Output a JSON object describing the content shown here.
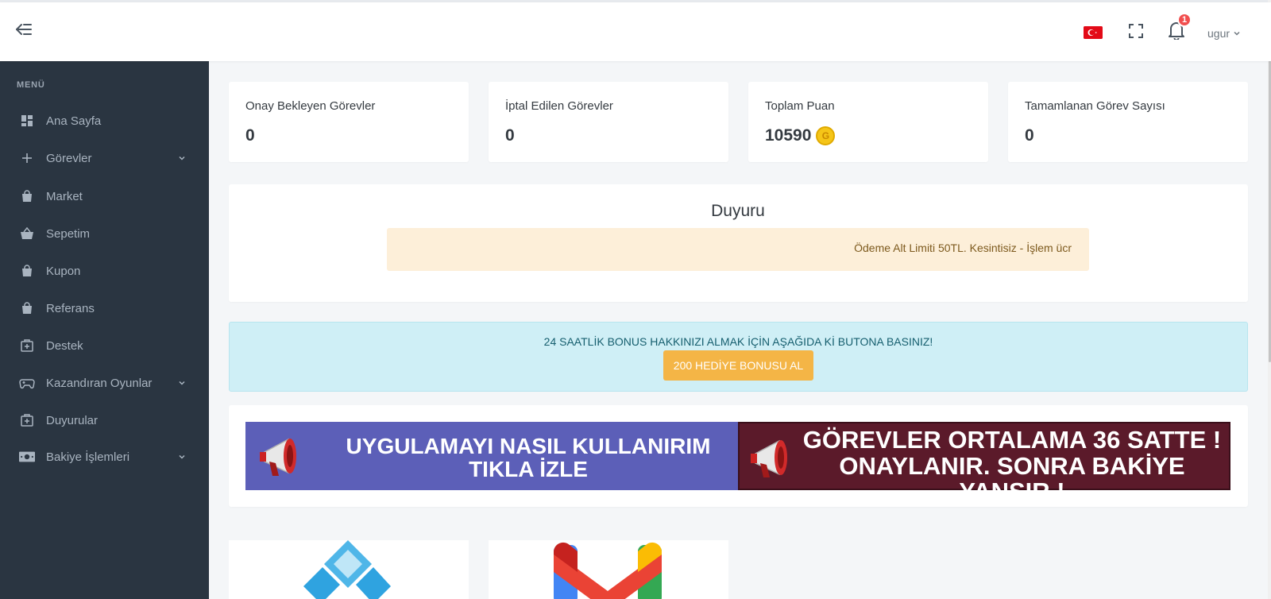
{
  "header": {
    "user_name": "ugur",
    "notification_count": "1"
  },
  "sidebar": {
    "title": "MENÜ",
    "items": [
      {
        "label": "Ana Sayfa"
      },
      {
        "label": "Görevler"
      },
      {
        "label": "Market"
      },
      {
        "label": "Sepetim"
      },
      {
        "label": "Kupon"
      },
      {
        "label": "Referans"
      },
      {
        "label": "Destek"
      },
      {
        "label": "Kazandıran Oyunlar"
      },
      {
        "label": "Duyurular"
      },
      {
        "label": "Bakiye İşlemleri"
      }
    ]
  },
  "stats": [
    {
      "title": "Onay Bekleyen Görevler",
      "value": "0"
    },
    {
      "title": "İptal Edilen Görevler",
      "value": "0"
    },
    {
      "title": "Toplam Puan",
      "value": "10590"
    },
    {
      "title": "Tamamlanan Görev Sayısı",
      "value": "0"
    }
  ],
  "coin_symbol": "G",
  "announcement": {
    "title": "Duyuru",
    "text": "Ödeme Alt Limiti 50TL. Kesintisiz - İşlem ücr"
  },
  "bonus": {
    "text": "24 SAATLİK BONUS HAKKINIZI ALMAK İÇİN AŞAĞIDA Kİ BUTONA BASINIZ!",
    "button": "200 HEDİYE BONUSU AL"
  },
  "banners": {
    "left_line1": "UYGULAMAYI NASIL KULLANIRIM",
    "left_line2": "TIKLA İZLE",
    "right_line1": "GÖREVLER ORTALAMA 36 SATTE !",
    "right_line2": "ONAYLANIR. SONRA BAKİYE YANSIR !"
  },
  "colors": {
    "sidebar_bg": "#2a3541",
    "accent_orange": "#f4b546",
    "bonus_bg": "#cfeff6",
    "announce_bg": "#fdefd9",
    "flag_red": "#e30a17"
  }
}
